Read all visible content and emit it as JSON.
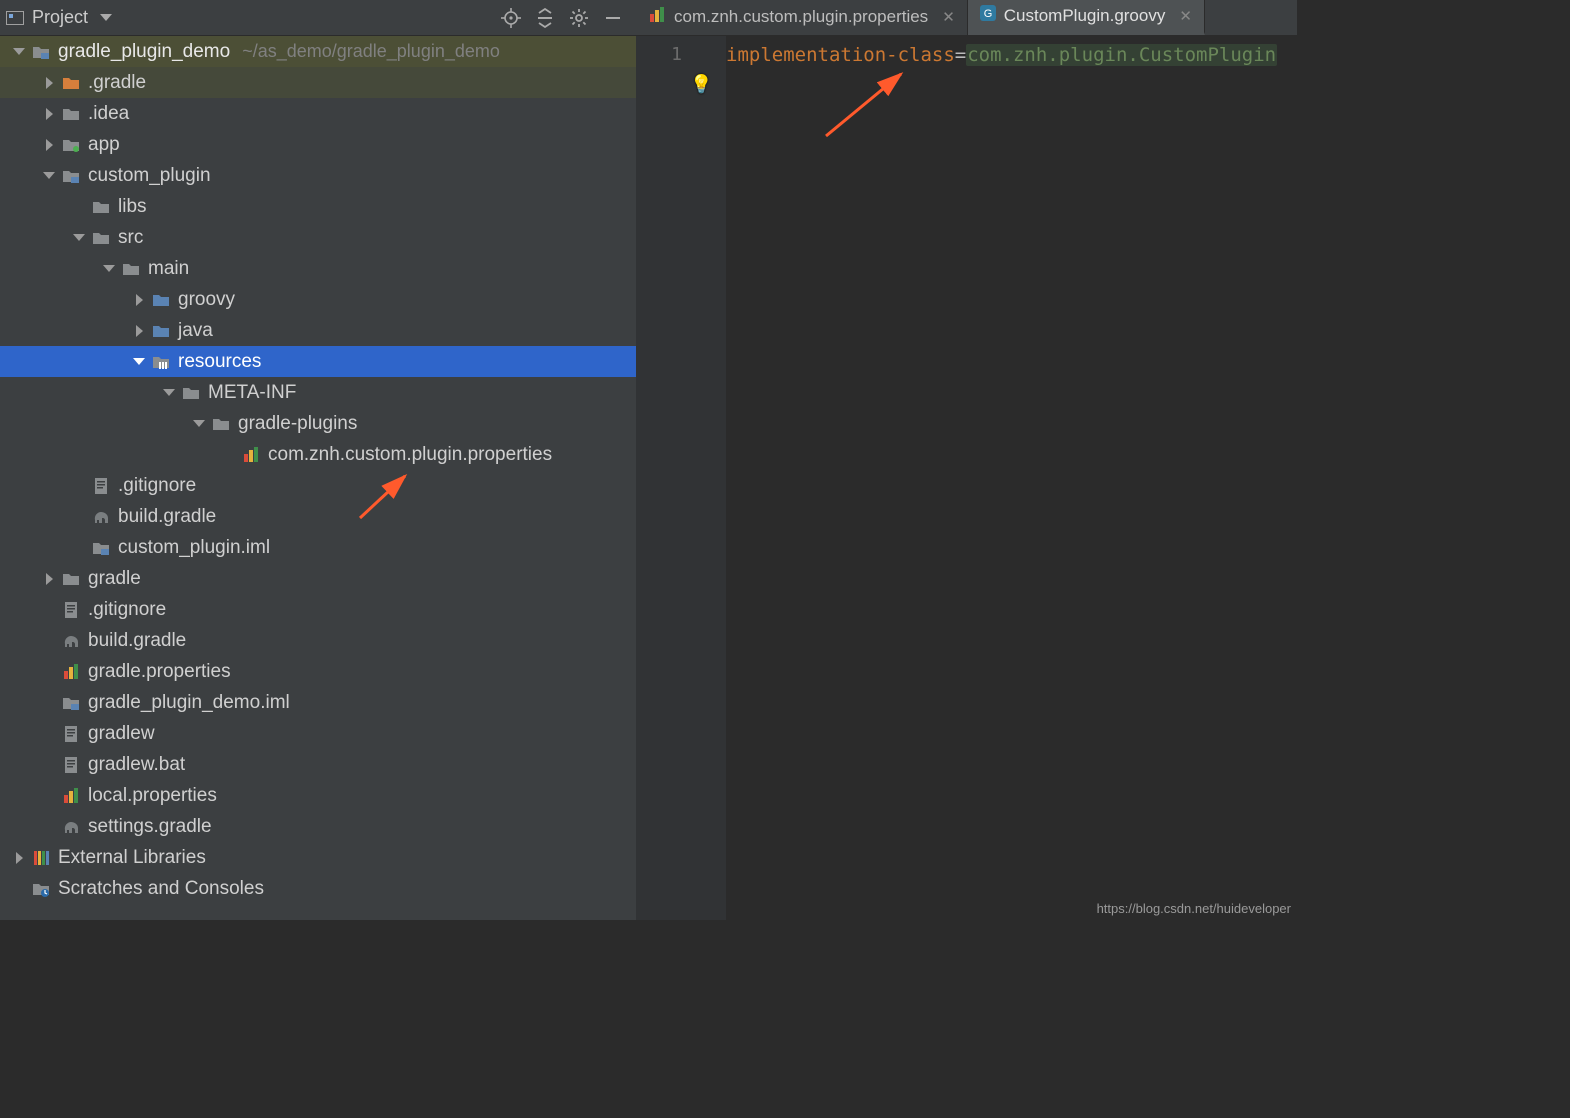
{
  "toolwindow": {
    "title": "Project",
    "header_icons": [
      "target-icon",
      "collapse-icon",
      "gear-icon",
      "minimize-icon"
    ]
  },
  "tree": [
    {
      "indent": 0,
      "toggle": "down",
      "icon": "module",
      "label": "gradle_plugin_demo",
      "hint": "~/as_demo/gradle_plugin_demo",
      "root": true
    },
    {
      "indent": 1,
      "toggle": "right",
      "icon": "folder-orange",
      "label": ".gradle",
      "orange": true
    },
    {
      "indent": 1,
      "toggle": "right",
      "icon": "folder",
      "label": ".idea"
    },
    {
      "indent": 1,
      "toggle": "right",
      "icon": "module-dot",
      "label": "app"
    },
    {
      "indent": 1,
      "toggle": "down",
      "icon": "module",
      "label": "custom_plugin"
    },
    {
      "indent": 2,
      "toggle": "none",
      "icon": "folder",
      "label": "libs"
    },
    {
      "indent": 2,
      "toggle": "down",
      "icon": "folder",
      "label": "src"
    },
    {
      "indent": 3,
      "toggle": "down",
      "icon": "folder",
      "label": "main"
    },
    {
      "indent": 4,
      "toggle": "right",
      "icon": "folder-blue",
      "label": "groovy"
    },
    {
      "indent": 4,
      "toggle": "right",
      "icon": "folder-blue",
      "label": "java"
    },
    {
      "indent": 4,
      "toggle": "down",
      "icon": "resources",
      "label": "resources",
      "selected": true
    },
    {
      "indent": 5,
      "toggle": "down",
      "icon": "folder",
      "label": "META-INF"
    },
    {
      "indent": 6,
      "toggle": "down",
      "icon": "folder",
      "label": "gradle-plugins"
    },
    {
      "indent": 7,
      "toggle": "none",
      "icon": "bars",
      "label": "com.znh.custom.plugin.properties"
    },
    {
      "indent": 2,
      "toggle": "none",
      "icon": "txt",
      "label": ".gitignore"
    },
    {
      "indent": 2,
      "toggle": "none",
      "icon": "elephant",
      "label": "build.gradle"
    },
    {
      "indent": 2,
      "toggle": "none",
      "icon": "module",
      "label": "custom_plugin.iml"
    },
    {
      "indent": 1,
      "toggle": "right",
      "icon": "folder",
      "label": "gradle"
    },
    {
      "indent": 1,
      "toggle": "none",
      "icon": "txt",
      "label": ".gitignore"
    },
    {
      "indent": 1,
      "toggle": "none",
      "icon": "elephant",
      "label": "build.gradle"
    },
    {
      "indent": 1,
      "toggle": "none",
      "icon": "bars",
      "label": "gradle.properties"
    },
    {
      "indent": 1,
      "toggle": "none",
      "icon": "module",
      "label": "gradle_plugin_demo.iml"
    },
    {
      "indent": 1,
      "toggle": "none",
      "icon": "txt",
      "label": "gradlew"
    },
    {
      "indent": 1,
      "toggle": "none",
      "icon": "txt",
      "label": "gradlew.bat"
    },
    {
      "indent": 1,
      "toggle": "none",
      "icon": "bars",
      "label": "local.properties"
    },
    {
      "indent": 1,
      "toggle": "none",
      "icon": "elephant",
      "label": "settings.gradle"
    },
    {
      "indent": 0,
      "toggle": "right",
      "icon": "lib",
      "label": "External Libraries"
    },
    {
      "indent": 0,
      "toggle": "none",
      "icon": "scratch",
      "label": "Scratches and Consoles"
    }
  ],
  "tabs": [
    {
      "icon": "bars",
      "label": "com.znh.custom.plugin.properties",
      "active": false
    },
    {
      "icon": "groovyfile",
      "label": "CustomPlugin.groovy",
      "active": true
    }
  ],
  "editor": {
    "line_number": "1",
    "code_key": "implementation-class",
    "code_eq": "=",
    "code_val": "com.znh.plugin.CustomPlugin"
  },
  "watermark": "https://blog.csdn.net/huideveloper"
}
